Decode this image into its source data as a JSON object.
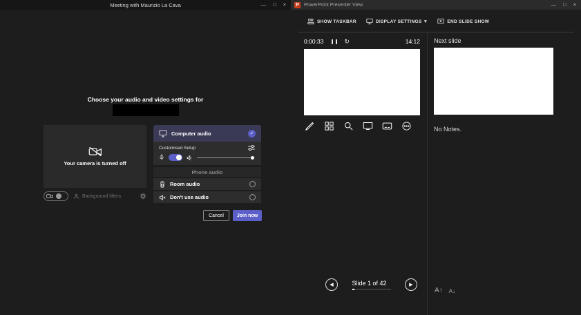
{
  "teams": {
    "title": "Meeting with Maurizio La Cava",
    "heading": "Choose your audio and video settings for",
    "camera": {
      "status": "Your camera is turned off",
      "background_filters_label": "Background filters"
    },
    "audio": {
      "computer_audio_label": "Computer audio",
      "customised_setup_label": "Customised Setup",
      "phone_audio_label": "Phone audio",
      "room_audio_label": "Room audio",
      "dont_use_audio_label": "Don't use audio"
    },
    "actions": {
      "cancel_label": "Cancel",
      "join_label": "Join now"
    },
    "accent_color": "#5b5fc7"
  },
  "powerpoint": {
    "title": "PowerPoint Presenter View",
    "toolbar": {
      "show_taskbar_label": "SHOW TASKBAR",
      "display_settings_label": "DISPLAY SETTINGS ▼",
      "end_slide_show_label": "END SLIDE SHOW"
    },
    "timer": {
      "elapsed": "0:00:33",
      "clock": "14:12"
    },
    "next_slide_label": "Next slide",
    "notes_text": "No Notes.",
    "slide_counter": "Slide 1 of 42",
    "brand_color": "#c43e1c"
  },
  "icons": {
    "window_minimize": "—",
    "window_maximize": "□",
    "window_close": "×",
    "powerpoint_logo": "P",
    "selected_check": "✓",
    "restart_timer": "↻",
    "nav_previous": "◀",
    "nav_next": "▶",
    "font_increase": "A↑",
    "font_decrease": "A↓"
  }
}
